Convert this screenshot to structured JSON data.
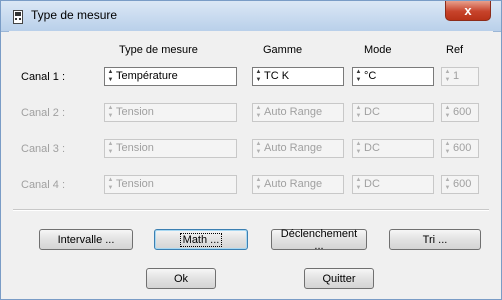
{
  "window": {
    "title": "Type de mesure",
    "close_glyph": "x"
  },
  "columns": [
    "Type de mesure",
    "Gamme",
    "Mode",
    "Ref"
  ],
  "rows": [
    {
      "label": "Canal 1 :",
      "type": "Température",
      "range": "TC K",
      "mode": "°C",
      "ref": "1",
      "enabled": true
    },
    {
      "label": "Canal 2 :",
      "type": "Tension",
      "range": "Auto Range",
      "mode": "DC",
      "ref": "600",
      "enabled": false
    },
    {
      "label": "Canal 3 :",
      "type": "Tension",
      "range": "Auto Range",
      "mode": "DC",
      "ref": "600",
      "enabled": false
    },
    {
      "label": "Canal 4 :",
      "type": "Tension",
      "range": "Auto Range",
      "mode": "DC",
      "ref": "600",
      "enabled": false
    }
  ],
  "buttons": {
    "intervalle": "Intervalle ...",
    "math": "Math ...",
    "declenchement": "Déclenchement ...",
    "tri": "Tri ...",
    "ok": "Ok",
    "quitter": "Quitter"
  },
  "icons": {
    "spin_up": "▲",
    "spin_down": "▼",
    "app": "app-icon"
  },
  "colors": {
    "titlebar": "#c8daef",
    "close": "#c7432b",
    "disabled_text": "#a0a0a0"
  }
}
